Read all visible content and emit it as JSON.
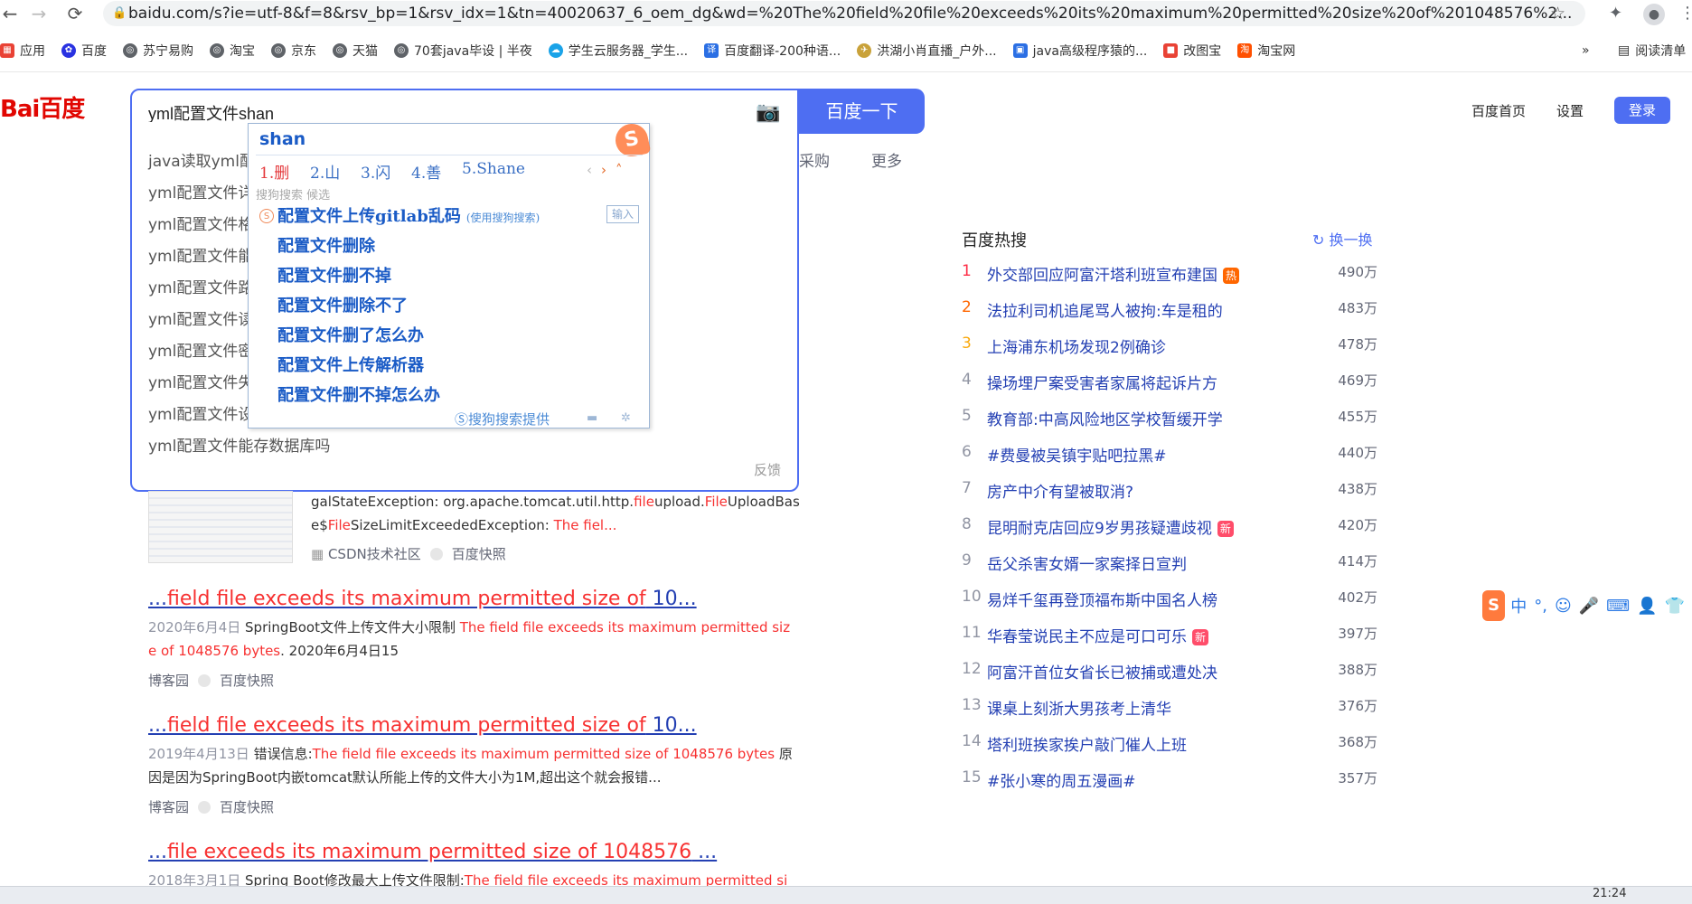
{
  "browser": {
    "url": "baidu.com/s?ie=utf-8&f=8&rsv_bp=1&rsv_idx=1&tn=40020637_6_oem_dg&wd=%20The%20field%20file%20exceeds%20its%20maximum%20permitted%20size%20of%201048576%2...",
    "bookmarks": [
      "应用",
      "百度",
      "苏宁易购",
      "淘宝",
      "京东",
      "天猫",
      "70套java毕设 | 半夜",
      "学生云服务器_学生...",
      "百度翻译-200种语...",
      "洪湖小肖直播_户外...",
      "java高级程序猿的...",
      "改图宝",
      "淘宝网"
    ],
    "more": "»",
    "reading_list": "阅读清单"
  },
  "baidu": {
    "logo": "Bai百度",
    "search_value": "yml配置文件shan",
    "search_button": "百度一下",
    "nav": {
      "home": "百度首页",
      "settings": "设置",
      "login": "登录"
    },
    "tabs": [
      "采购",
      "更多"
    ],
    "suggestions": [
      "java读取yml配",
      "yml配置文件详",
      "yml配置文件格",
      "yml配置文件能",
      "yml配置文件路",
      "yml配置文件读",
      "yml配置文件密",
      "yml配置文件失",
      "yml配置文件设",
      "yml配置文件能存数据库吗"
    ],
    "feedback": "反馈"
  },
  "ime": {
    "pinyin": "shan",
    "candidates": [
      "1.删",
      "2.山",
      "3.闪",
      "4.善",
      "5.Shane"
    ],
    "hint": "搜狗搜索  候选",
    "rows": [
      "配置文件上传gitlab乱码",
      "配置文件删除",
      "配置文件删不掉",
      "配置文件删除不了",
      "配置文件删了怎么办",
      "配置文件上传解析器",
      "配置文件删不掉怎么办"
    ],
    "first_row_sub": "(使用搜狗搜索)",
    "input_btn": "输入",
    "footer": "搜狗搜索提供"
  },
  "results": {
    "r0": {
      "line1_a": "galStateException: org.apache.tomcat.util.http.",
      "line1_em1": "file",
      "line1_b": "upload.",
      "line1_em2": "File",
      "line1_c": "UploadBas",
      "line2_a": "e$",
      "line2_em": "File",
      "line2_b": "SizeLimitExceededException: ",
      "line2_em2": "The fiel...",
      "source": "CSDN技术社区",
      "snapshot": "百度快照"
    },
    "r1": {
      "title_a": "...",
      "title_em": "field file exceeds its maximum permitted size of",
      "title_b": " 10...",
      "date": "2020年6月4日",
      "text_a": " SpringBoot文件上传文件大小限制 ",
      "text_em1": "The field file exceeds its maximum permitted siz",
      "text_em2": "e of 1048576 bytes",
      "text_b": ". 2020年6月4日15",
      "source": "博客园",
      "snapshot": "百度快照"
    },
    "r2": {
      "title_a": "...",
      "title_em": "field file exceeds its maximum permitted size of",
      "title_b": " 10...",
      "date": "2019年4月13日",
      "text_a": " 错误信息:",
      "text_em": "The field file exceeds its maximum permitted size of 1048576 bytes",
      "text_b": " 原",
      "line2": "因是因为SpringBoot内嵌tomcat默认所能上传的文件大小为1M,超出这个就会报错...",
      "source": "博客园",
      "snapshot": "百度快照"
    },
    "r3": {
      "title_a": "...",
      "title_em": "file exceeds its maximum permitted size of 1048576",
      "title_b": " ...",
      "date": "2018年3月1日",
      "text_a": " Spring Boot修改最大上传文件限制:",
      "text_em": "The field file exceeds its maximum permitted si"
    }
  },
  "hot": {
    "title": "百度热搜",
    "refresh": "换一换",
    "items": [
      {
        "rank": "1",
        "title": "外交部回应阿富汗塔利班宣布建国",
        "badge": "热",
        "count": "490万"
      },
      {
        "rank": "2",
        "title": "法拉利司机追尾骂人被拘:车是租的",
        "badge": "",
        "count": "483万"
      },
      {
        "rank": "3",
        "title": "上海浦东机场发现2例确诊",
        "badge": "",
        "count": "478万"
      },
      {
        "rank": "4",
        "title": "操场埋尸案受害者家属将起诉片方",
        "badge": "",
        "count": "469万"
      },
      {
        "rank": "5",
        "title": "教育部:中高风险地区学校暂缓开学",
        "badge": "",
        "count": "455万"
      },
      {
        "rank": "6",
        "title": "#费曼被吴镇宇贴吧拉黑#",
        "badge": "",
        "count": "440万"
      },
      {
        "rank": "7",
        "title": "房产中介有望被取消?",
        "badge": "",
        "count": "438万"
      },
      {
        "rank": "8",
        "title": "昆明耐克店回应9岁男孩疑遭歧视",
        "badge": "新",
        "count": "420万"
      },
      {
        "rank": "9",
        "title": "岳父杀害女婿一家案择日宣判",
        "badge": "",
        "count": "414万"
      },
      {
        "rank": "10",
        "title": "易烊千玺再登顶福布斯中国名人榜",
        "badge": "",
        "count": "402万"
      },
      {
        "rank": "11",
        "title": "华春莹说民主不应是可口可乐",
        "badge": "新",
        "count": "397万"
      },
      {
        "rank": "12",
        "title": "阿富汗首位女省长已被捕或遭处决",
        "badge": "",
        "count": "388万"
      },
      {
        "rank": "13",
        "title": "课桌上刻浙大男孩考上清华",
        "badge": "",
        "count": "376万"
      },
      {
        "rank": "14",
        "title": "塔利班挨家挨户敲门催人上班",
        "badge": "",
        "count": "368万"
      },
      {
        "rank": "15",
        "title": "#张小寒的周五漫画#",
        "badge": "",
        "count": "357万"
      }
    ]
  },
  "sogou_bar": {
    "logo": "S",
    "mode": "中"
  },
  "taskbar": {
    "time": "21:24"
  },
  "colors": {
    "accent": "#4e6ef2",
    "hot_red": "#f73131",
    "link": "#2440b3",
    "badge_hot": "#ff6600",
    "badge_new": "#ff4d6a"
  }
}
